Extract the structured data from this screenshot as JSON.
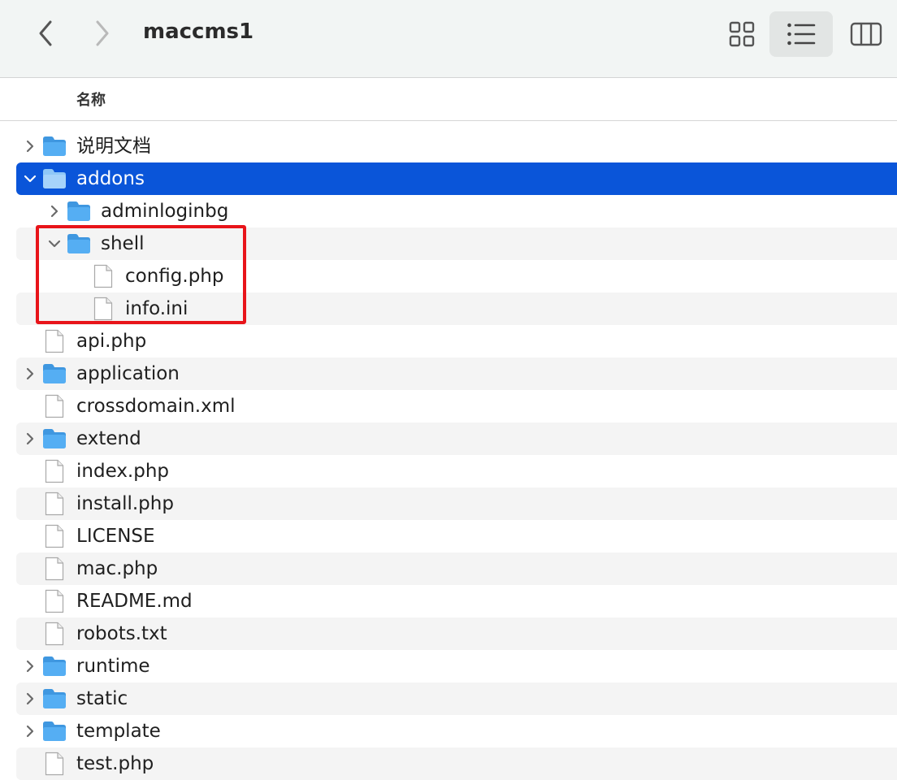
{
  "toolbar": {
    "title": "maccms1",
    "back_icon": "chevron-left-icon",
    "forward_icon": "chevron-right-icon",
    "views": [
      "grid-view-icon",
      "list-view-icon",
      "column-view-icon"
    ],
    "active_view": "list"
  },
  "header": {
    "name_column": "名称"
  },
  "colors": {
    "selection": "#0a55d9",
    "folder": "#4ea8f2",
    "highlight_box": "#e8141a",
    "stripe": "#f4f4f4"
  },
  "files": [
    {
      "name": "说明文档",
      "type": "folder",
      "depth": 0,
      "disclosure": "collapsed"
    },
    {
      "name": "addons",
      "type": "folder",
      "depth": 0,
      "disclosure": "expanded",
      "selected": true
    },
    {
      "name": "adminloginbg",
      "type": "folder",
      "depth": 1,
      "disclosure": "collapsed"
    },
    {
      "name": "shell",
      "type": "folder",
      "depth": 1,
      "disclosure": "expanded"
    },
    {
      "name": "config.php",
      "type": "file",
      "depth": 2
    },
    {
      "name": "info.ini",
      "type": "file",
      "depth": 2
    },
    {
      "name": "api.php",
      "type": "file",
      "depth": 0
    },
    {
      "name": "application",
      "type": "folder",
      "depth": 0,
      "disclosure": "collapsed"
    },
    {
      "name": "crossdomain.xml",
      "type": "file",
      "depth": 0
    },
    {
      "name": "extend",
      "type": "folder",
      "depth": 0,
      "disclosure": "collapsed"
    },
    {
      "name": "index.php",
      "type": "file",
      "depth": 0
    },
    {
      "name": "install.php",
      "type": "file",
      "depth": 0
    },
    {
      "name": "LICENSE",
      "type": "file",
      "depth": 0
    },
    {
      "name": "mac.php",
      "type": "file",
      "depth": 0
    },
    {
      "name": "README.md",
      "type": "file",
      "depth": 0
    },
    {
      "name": "robots.txt",
      "type": "file",
      "depth": 0
    },
    {
      "name": "runtime",
      "type": "folder",
      "depth": 0,
      "disclosure": "collapsed"
    },
    {
      "name": "static",
      "type": "folder",
      "depth": 0,
      "disclosure": "collapsed"
    },
    {
      "name": "template",
      "type": "folder",
      "depth": 0,
      "disclosure": "collapsed"
    },
    {
      "name": "test.php",
      "type": "file",
      "depth": 0
    }
  ]
}
